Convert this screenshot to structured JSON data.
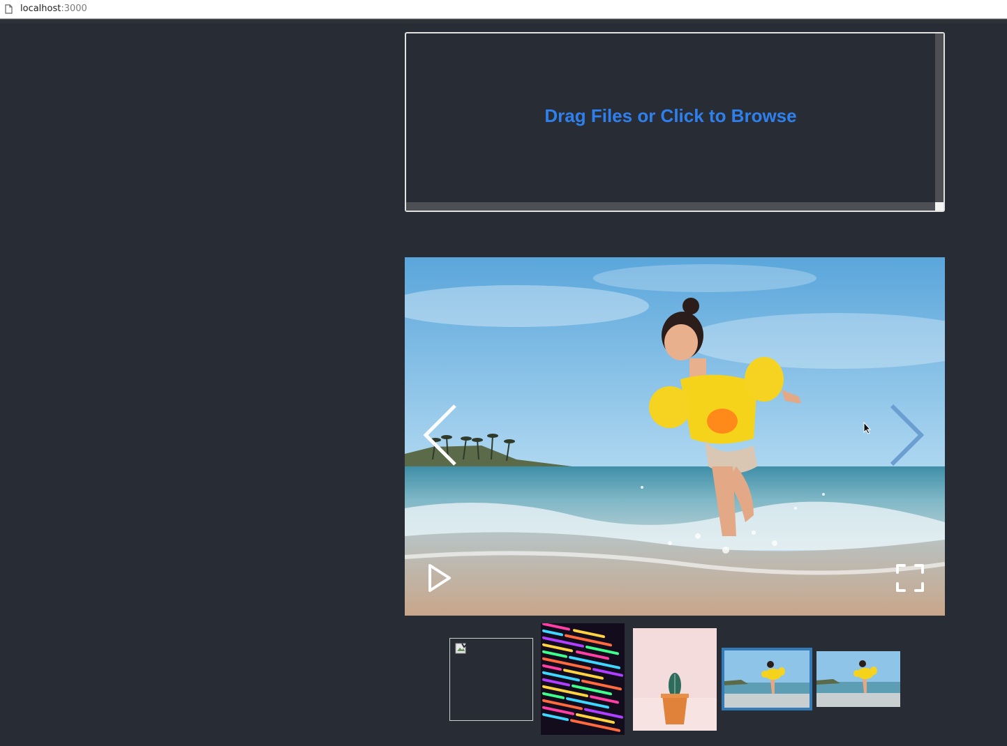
{
  "browser": {
    "url_host": "localhost",
    "url_port": ":3000"
  },
  "dropzone": {
    "label": "Drag Files or Click to Browse",
    "accent_color": "#2f80ed"
  },
  "gallery": {
    "active_index": 3,
    "icons": {
      "prev": "chevron-left-icon",
      "next": "chevron-right-icon",
      "play": "play-icon",
      "fullscreen": "fullscreen-icon"
    },
    "thumbnails": [
      {
        "name": "broken-image"
      },
      {
        "name": "colorful-code"
      },
      {
        "name": "cactus-pot"
      },
      {
        "name": "girl-at-beach"
      },
      {
        "name": "girl-at-beach"
      }
    ],
    "active_border_color": "#337ab7"
  }
}
